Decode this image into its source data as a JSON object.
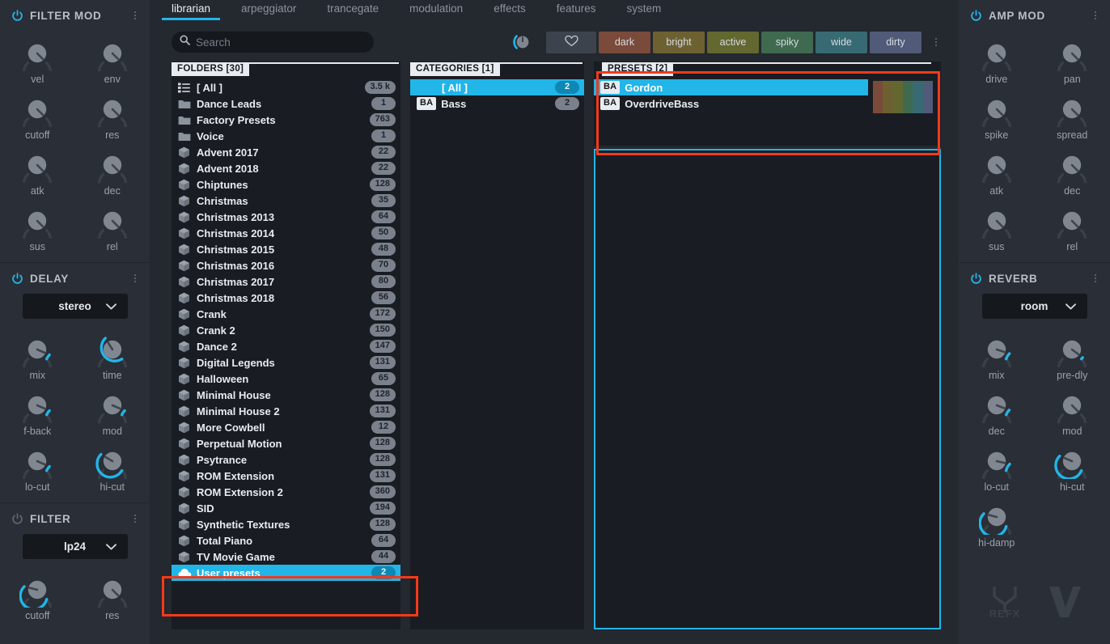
{
  "tabs": [
    {
      "label": "librarian",
      "active": true
    },
    {
      "label": "arpeggiator",
      "active": false
    },
    {
      "label": "trancegate",
      "active": false
    },
    {
      "label": "modulation",
      "active": false
    },
    {
      "label": "effects",
      "active": false
    },
    {
      "label": "features",
      "active": false
    },
    {
      "label": "system",
      "active": false
    }
  ],
  "search": {
    "placeholder": "Search",
    "value": "",
    "icon": "search-icon"
  },
  "tagbar": {
    "knob_icon": "tag-filter-knob",
    "favorite_icon": "heart-icon",
    "menu_icon": "kebab-menu-icon",
    "tags": [
      {
        "label": "dark",
        "color": "#7a4a3a"
      },
      {
        "label": "bright",
        "color": "#6d6132"
      },
      {
        "label": "active",
        "color": "#62682f"
      },
      {
        "label": "spiky",
        "color": "#3f6a50"
      },
      {
        "label": "wide",
        "color": "#376a72"
      },
      {
        "label": "dirty",
        "color": "#515a78"
      }
    ]
  },
  "folders": {
    "header": "FOLDERS [30]",
    "items": [
      {
        "name": "[ All ]",
        "count": "3.5 k",
        "icon": "list-icon",
        "selected": false
      },
      {
        "name": "Dance Leads",
        "count": "1",
        "icon": "folder-icon",
        "selected": false
      },
      {
        "name": "Factory Presets",
        "count": "763",
        "icon": "folder-icon",
        "selected": false
      },
      {
        "name": "Voice",
        "count": "1",
        "icon": "folder-icon",
        "selected": false
      },
      {
        "name": "Advent 2017",
        "count": "22",
        "icon": "box-icon",
        "selected": false
      },
      {
        "name": "Advent 2018",
        "count": "22",
        "icon": "box-icon",
        "selected": false
      },
      {
        "name": "Chiptunes",
        "count": "128",
        "icon": "box-icon",
        "selected": false
      },
      {
        "name": "Christmas",
        "count": "35",
        "icon": "box-icon",
        "selected": false
      },
      {
        "name": "Christmas 2013",
        "count": "64",
        "icon": "box-icon",
        "selected": false
      },
      {
        "name": "Christmas 2014",
        "count": "50",
        "icon": "box-icon",
        "selected": false
      },
      {
        "name": "Christmas 2015",
        "count": "48",
        "icon": "box-icon",
        "selected": false
      },
      {
        "name": "Christmas 2016",
        "count": "70",
        "icon": "box-icon",
        "selected": false
      },
      {
        "name": "Christmas 2017",
        "count": "80",
        "icon": "box-icon",
        "selected": false
      },
      {
        "name": "Christmas 2018",
        "count": "56",
        "icon": "box-icon",
        "selected": false
      },
      {
        "name": "Crank",
        "count": "172",
        "icon": "box-icon",
        "selected": false
      },
      {
        "name": "Crank 2",
        "count": "150",
        "icon": "box-icon",
        "selected": false
      },
      {
        "name": "Dance 2",
        "count": "147",
        "icon": "box-icon",
        "selected": false
      },
      {
        "name": "Digital Legends",
        "count": "131",
        "icon": "box-icon",
        "selected": false
      },
      {
        "name": "Halloween",
        "count": "65",
        "icon": "box-icon",
        "selected": false
      },
      {
        "name": "Minimal House",
        "count": "128",
        "icon": "box-icon",
        "selected": false
      },
      {
        "name": "Minimal House 2",
        "count": "131",
        "icon": "box-icon",
        "selected": false
      },
      {
        "name": "More Cowbell",
        "count": "12",
        "icon": "box-icon",
        "selected": false
      },
      {
        "name": "Perpetual Motion",
        "count": "128",
        "icon": "box-icon",
        "selected": false
      },
      {
        "name": "Psytrance",
        "count": "128",
        "icon": "box-icon",
        "selected": false
      },
      {
        "name": "ROM Extension",
        "count": "131",
        "icon": "box-icon",
        "selected": false
      },
      {
        "name": "ROM Extension 2",
        "count": "360",
        "icon": "box-icon",
        "selected": false
      },
      {
        "name": "SID",
        "count": "194",
        "icon": "box-icon",
        "selected": false
      },
      {
        "name": "Synthetic Textures",
        "count": "128",
        "icon": "box-icon",
        "selected": false
      },
      {
        "name": "Total Piano",
        "count": "64",
        "icon": "box-icon",
        "selected": false
      },
      {
        "name": "TV Movie Game",
        "count": "44",
        "icon": "box-icon",
        "selected": false
      },
      {
        "name": "User presets",
        "count": "2",
        "icon": "cloud-icon",
        "selected": true
      }
    ]
  },
  "categories": {
    "header": "CATEGORIES [1]",
    "items": [
      {
        "name": "[ All ]",
        "count": "2",
        "badge": "",
        "selected": true
      },
      {
        "name": "Bass",
        "count": "2",
        "badge": "BA",
        "selected": false
      }
    ]
  },
  "presets": {
    "header": "PRESETS [2]",
    "items": [
      {
        "name": "Gordon",
        "badge": "BA",
        "selected": true
      },
      {
        "name": "OverdriveBass",
        "badge": "BA",
        "selected": false
      }
    ],
    "swatch_colors": [
      "#7a4a3a",
      "#6d6132",
      "#62682f",
      "#3f6a50",
      "#376a72",
      "#515a78"
    ]
  },
  "left_rack": {
    "sections": [
      {
        "title": "FILTER MOD",
        "power_on": true,
        "dropdown": null,
        "knobs": [
          {
            "label": "vel",
            "value": 0,
            "active": false
          },
          {
            "label": "env",
            "value": 0,
            "active": false
          },
          {
            "label": "cutoff",
            "value": 0,
            "active": false
          },
          {
            "label": "res",
            "value": 0,
            "active": false
          },
          {
            "label": "atk",
            "value": 0,
            "active": false
          },
          {
            "label": "dec",
            "value": 0,
            "active": false
          },
          {
            "label": "sus",
            "value": 0,
            "active": false
          },
          {
            "label": "rel",
            "value": 0,
            "active": false
          }
        ]
      },
      {
        "title": "DELAY",
        "power_on": true,
        "dropdown": {
          "value": "stereo"
        },
        "knobs": [
          {
            "label": "mix",
            "value": 8,
            "active": true
          },
          {
            "label": "time",
            "value": 62,
            "active": true
          },
          {
            "label": "f-back",
            "value": 8,
            "active": true
          },
          {
            "label": "mod",
            "value": 8,
            "active": true
          },
          {
            "label": "lo-cut",
            "value": 8,
            "active": true
          },
          {
            "label": "hi-cut",
            "value": 72,
            "active": true
          }
        ]
      },
      {
        "title": "FILTER",
        "power_on": false,
        "dropdown": {
          "value": "lp24"
        },
        "knobs": [
          {
            "label": "cutoff",
            "value": 78,
            "active": true
          },
          {
            "label": "res",
            "value": 0,
            "active": false
          }
        ]
      }
    ]
  },
  "right_rack": {
    "sections": [
      {
        "title": "AMP MOD",
        "power_on": true,
        "dropdown": null,
        "knobs": [
          {
            "label": "drive",
            "value": 0,
            "active": false
          },
          {
            "label": "pan",
            "value": 0,
            "active": false
          },
          {
            "label": "spike",
            "value": 0,
            "active": false
          },
          {
            "label": "spread",
            "value": 0,
            "active": false
          },
          {
            "label": "atk",
            "value": 0,
            "active": false
          },
          {
            "label": "dec",
            "value": 0,
            "active": false
          },
          {
            "label": "sus",
            "value": 0,
            "active": false
          },
          {
            "label": "rel",
            "value": 0,
            "active": false
          }
        ]
      },
      {
        "title": "REVERB",
        "power_on": true,
        "dropdown": {
          "value": "room"
        },
        "knobs": [
          {
            "label": "mix",
            "value": 10,
            "active": true
          },
          {
            "label": "pre-dly",
            "value": 3,
            "active": true
          },
          {
            "label": "dec",
            "value": 9,
            "active": true
          },
          {
            "label": "mod",
            "value": 0,
            "active": false
          },
          {
            "label": "lo-cut",
            "value": 12,
            "active": true
          },
          {
            "label": "hi-cut",
            "value": 75,
            "active": true
          },
          {
            "label": "hi-damp",
            "value": 78,
            "active": true
          }
        ]
      }
    ],
    "logos": [
      "refx-logo",
      "vanguard-v-logo"
    ]
  },
  "annotations": [
    {
      "name": "presets-panel-highlight"
    },
    {
      "name": "user-presets-row-highlight"
    }
  ],
  "colors": {
    "accent": "#22b5e8",
    "annotation": "#f5391a",
    "panel_bg": "#191d23",
    "rack_bg": "#2a2e36",
    "app_bg": "#24282f"
  }
}
